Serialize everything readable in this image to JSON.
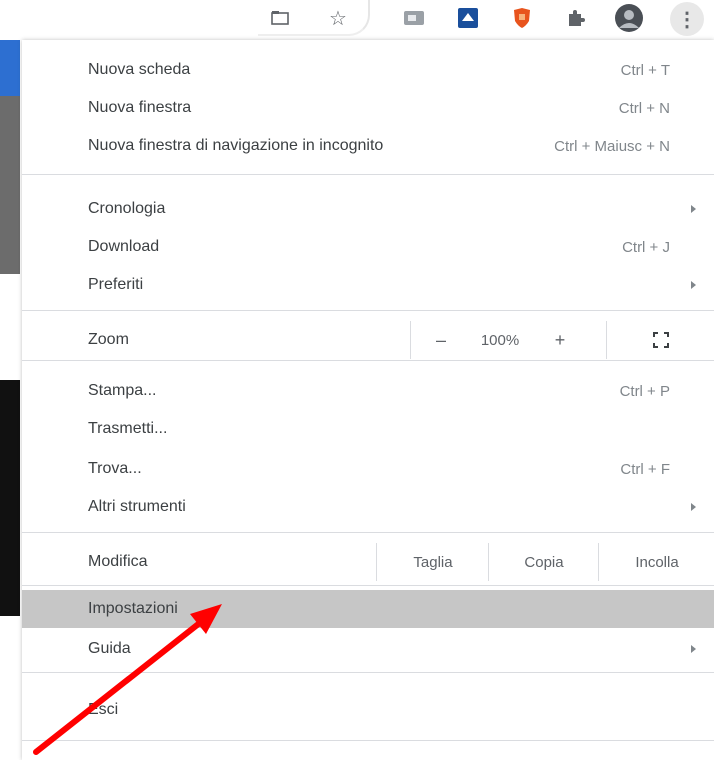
{
  "colors": {
    "menu_bg": "#ffffff",
    "highlight": "#c6c6c6",
    "text": "#3c4043",
    "shortcut": "#80868b",
    "separator": "#dadce0",
    "annotation_arrow": "#ff0000"
  },
  "toolbar": {
    "icons": [
      "tab-search-icon",
      "bookmark-star-icon",
      "extension-image-icon",
      "extension-blue-icon",
      "extension-shield-icon",
      "extensions-puzzle-icon",
      "profile-avatar-icon",
      "menu-kebab-icon"
    ],
    "kebab_glyph": "⋮",
    "star_glyph": "☆"
  },
  "menu": {
    "new_tab": {
      "label": "Nuova scheda",
      "shortcut": "Ctrl + T"
    },
    "new_window": {
      "label": "Nuova finestra",
      "shortcut": "Ctrl + N"
    },
    "incognito": {
      "label": "Nuova finestra di navigazione in incognito",
      "shortcut": "Ctrl + Maiusc + N"
    },
    "history": {
      "label": "Cronologia"
    },
    "downloads": {
      "label": "Download",
      "shortcut": "Ctrl + J"
    },
    "bookmarks": {
      "label": "Preferiti"
    },
    "zoom": {
      "label": "Zoom",
      "minus": "–",
      "value": "100%",
      "plus": "+",
      "fullscreen": "⛶"
    },
    "print": {
      "label": "Stampa...",
      "shortcut": "Ctrl + P"
    },
    "cast": {
      "label": "Trasmetti..."
    },
    "find": {
      "label": "Trova...",
      "shortcut": "Ctrl + F"
    },
    "more_tools": {
      "label": "Altri strumenti"
    },
    "edit": {
      "label": "Modifica",
      "cut": "Taglia",
      "copy": "Copia",
      "paste": "Incolla"
    },
    "settings": {
      "label": "Impostazioni"
    },
    "help": {
      "label": "Guida"
    },
    "exit": {
      "label": "Esci"
    }
  }
}
